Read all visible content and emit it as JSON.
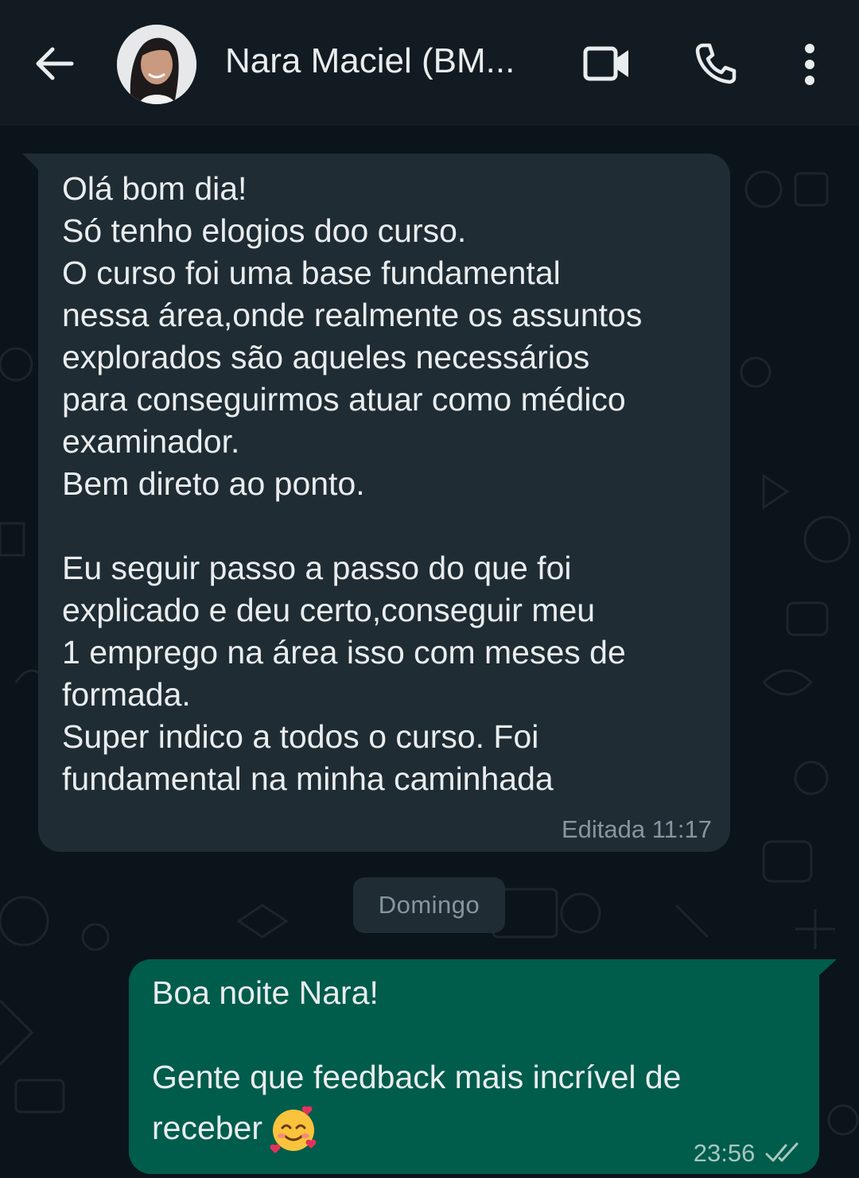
{
  "header": {
    "title": "Nara Maciel (BM...",
    "icons": [
      "back-arrow-icon",
      "video-call-icon",
      "phone-icon",
      "more-vert-icon"
    ]
  },
  "messages": [
    {
      "direction": "incoming",
      "text": "Olá bom dia!\nSó tenho elogios doo curso.\nO curso foi uma base fundamental\nnessa área,onde realmente os assuntos\nexplorados são aqueles necessários\npara conseguirmos atuar como médico\nexaminador.\nBem direto ao ponto.\n\nEu seguir passo a passo do que foi\nexplicado e deu certo,conseguir meu\n1 emprego na área isso com meses de\nformada.\nSuper indico a todos o curso. Foi\nfundamental na minha caminhada",
      "edited_label": "Editada",
      "time": "11:17"
    },
    {
      "direction": "outgoing",
      "text_line1": "Boa noite Nara!",
      "text_line2": "Gente que feedback mais incrível de",
      "text_line3": "receber",
      "emoji": "smiling-face-with-hearts-icon",
      "time": "23:56",
      "status": "double-check-icon"
    }
  ],
  "date_separator": "Domingo",
  "colors": {
    "background": "#0b141a",
    "header": "#111b21",
    "incoming_bubble": "#202c33",
    "outgoing_bubble": "#005c4b",
    "meta_text": "#8696a0"
  }
}
